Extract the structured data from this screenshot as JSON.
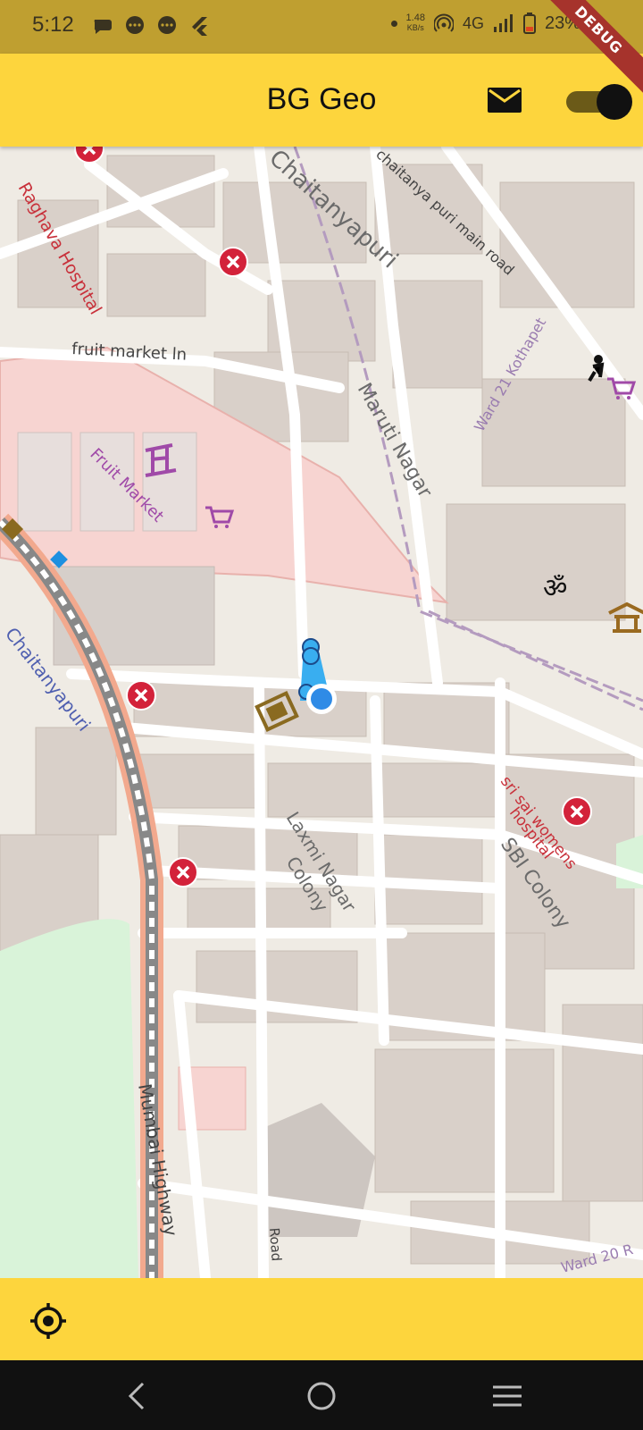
{
  "status_bar": {
    "time": "5:12",
    "net_speed_value": "1.48",
    "net_speed_unit": "KB/s",
    "network_type": "4G",
    "battery": "23%",
    "notification_icons": [
      "chat-bubble-icon",
      "message-icon",
      "message-icon",
      "flutter-icon"
    ]
  },
  "debug_banner": "DEBUG",
  "app_bar": {
    "title": "BG Geo",
    "mail_icon": "mail-icon",
    "toggle_on": true
  },
  "map": {
    "labels": {
      "hospital": "Raghava Hospital",
      "chaitanyapuri_top": "Chaitanyapuri",
      "main_road": "chaitanya puri main road",
      "fruit_market_ln": "fruit market ln",
      "ward": "Ward 21 Kothapet",
      "maruti": "Maruti Nagar",
      "fruit_market": "Fruit Market",
      "chaitanyapuri_left": "Chaitanyapuri",
      "sri_sai_1": "sri sai womens",
      "sri_sai_2": "hospital",
      "sbi_1": "SBI Colony",
      "laxmi_1": "Laxmi Nagar",
      "laxmi_2": "Colony",
      "highway": "Mumbai Highway",
      "road": "Road",
      "ward20": "Ward 20 R"
    }
  },
  "colors": {
    "status_bar": "#bf9f30",
    "app_bar": "#fdd53d",
    "location_blue": "#2f8be6",
    "marker_red": "#d3223a"
  },
  "bottom_bar": {
    "locate_icon": "gps-locate-icon"
  }
}
